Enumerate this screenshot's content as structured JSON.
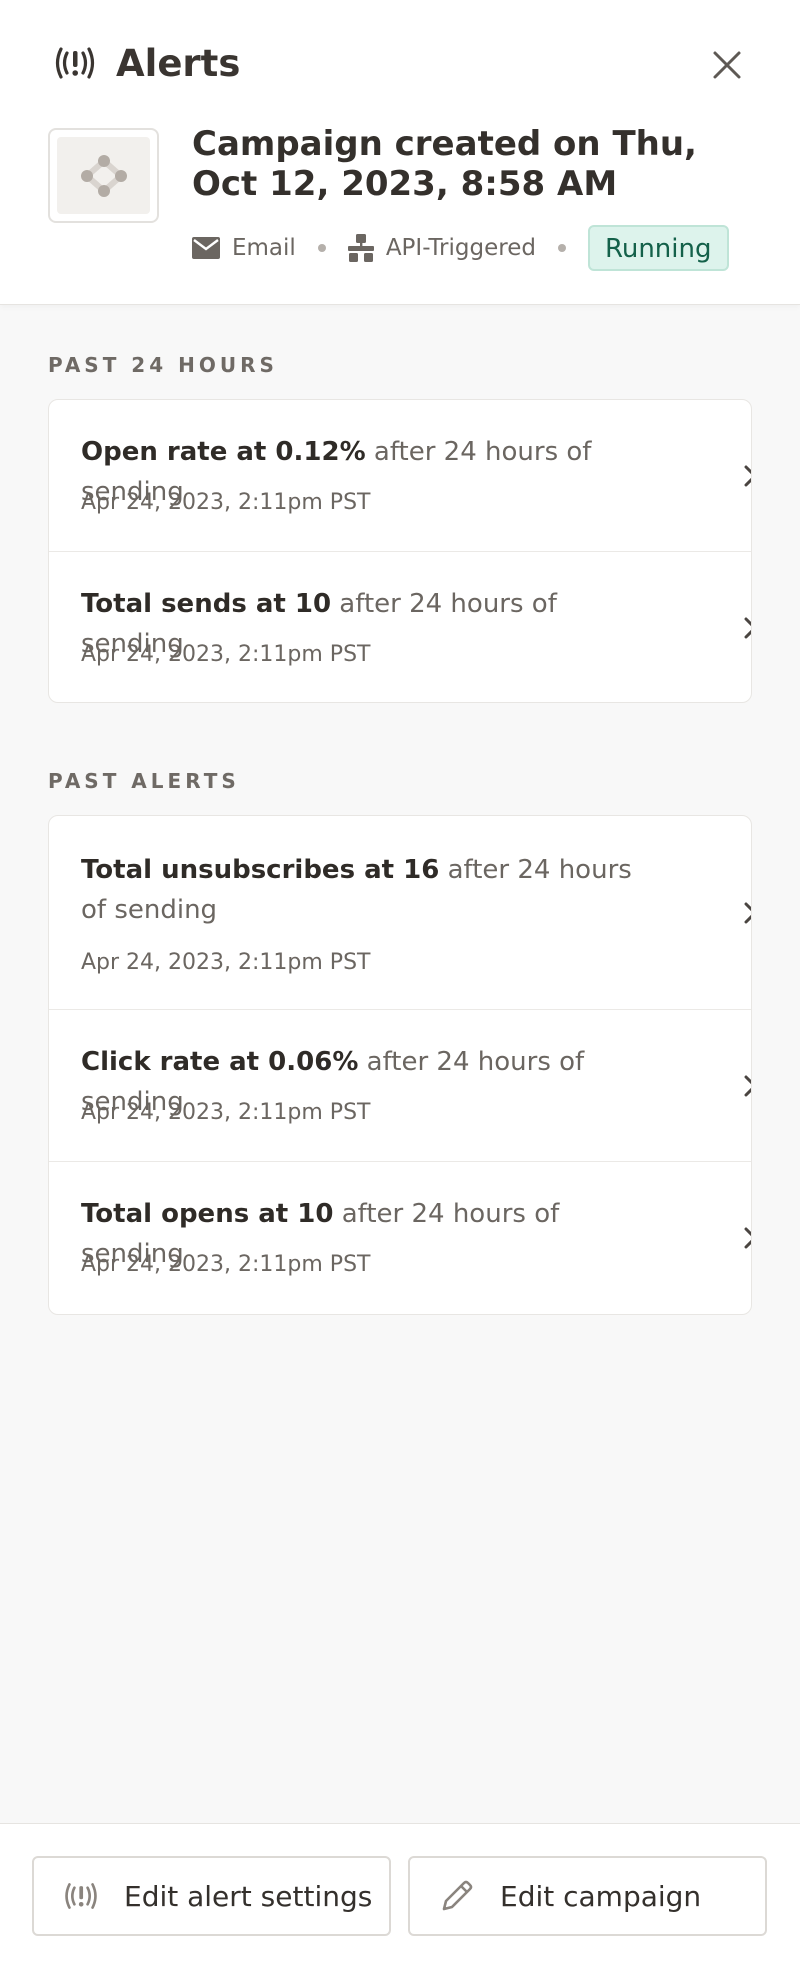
{
  "header": {
    "title": "Alerts",
    "campaign_title": "Campaign created on Thu, Oct 12, 2023, 8:58 AM",
    "meta": {
      "channel": "Email",
      "trigger": "API-Triggered",
      "status": "Running"
    }
  },
  "sections": [
    {
      "label": "PAST 24 HOURS",
      "alerts": [
        {
          "metric": "Open rate at 0.12%",
          "rest": " after 24 hours of sending",
          "date": "Apr 24, 2023, 2:11pm PST"
        },
        {
          "metric": "Total sends at 10",
          "rest": " after 24 hours of sending",
          "date": "Apr 24, 2023, 2:11pm PST"
        }
      ]
    },
    {
      "label": "PAST ALERTS",
      "alerts": [
        {
          "metric": "Total unsubscribes at 16",
          "rest": " after 24 hours of sending",
          "date": "Apr 24, 2023, 2:11pm PST"
        },
        {
          "metric": "Click rate at 0.06%",
          "rest": " after 24 hours of sending",
          "date": "Apr 24, 2023, 2:11pm PST"
        },
        {
          "metric": "Total opens at 10",
          "rest": " after 24 hours of sending",
          "date": "Apr 24, 2023, 2:11pm PST"
        }
      ]
    }
  ],
  "footer": {
    "edit_alert_settings": "Edit alert settings",
    "edit_campaign": "Edit campaign"
  },
  "icons": {
    "title": "alert-signal-icon",
    "close": "close-icon",
    "thumbnail": "campaign-flow-icon",
    "channel": "envelope-icon",
    "trigger": "api-icon",
    "row": "chevron-right-icon",
    "edit_campaign": "pencil-icon"
  },
  "colors": {
    "status_bg": "#ddf3ec",
    "status_text": "#14614a",
    "background": "#f8f8f8"
  }
}
